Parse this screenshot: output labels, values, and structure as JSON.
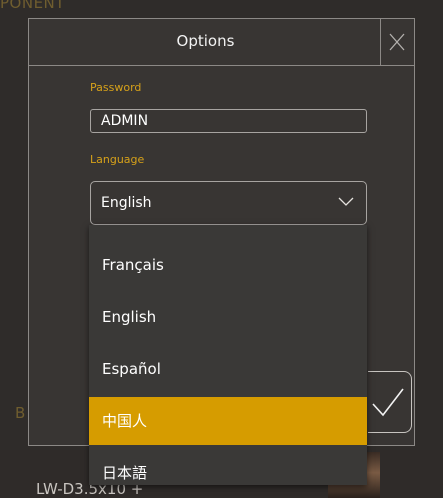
{
  "background": {
    "top_label": "PONENT",
    "side_label": "B",
    "device_label": "LW-D3.5x10 +"
  },
  "dialog": {
    "title": "Options",
    "close_icon": "close-icon",
    "password": {
      "label": "Password",
      "value": "ADMIN"
    },
    "language": {
      "label": "Language",
      "selected": "English",
      "chevron_icon": "chevron-down-icon",
      "options": [
        "Français",
        "English",
        "Español",
        "中国人",
        "日本語"
      ],
      "highlighted": "中国人"
    },
    "confirm_icon": "checkmark-icon"
  },
  "colors": {
    "accent": "#d69c00",
    "label_gold": "#d6a11a",
    "dialog_bg": "#383533",
    "dropdown_bg": "#3a3937",
    "border": "#8c8986"
  }
}
